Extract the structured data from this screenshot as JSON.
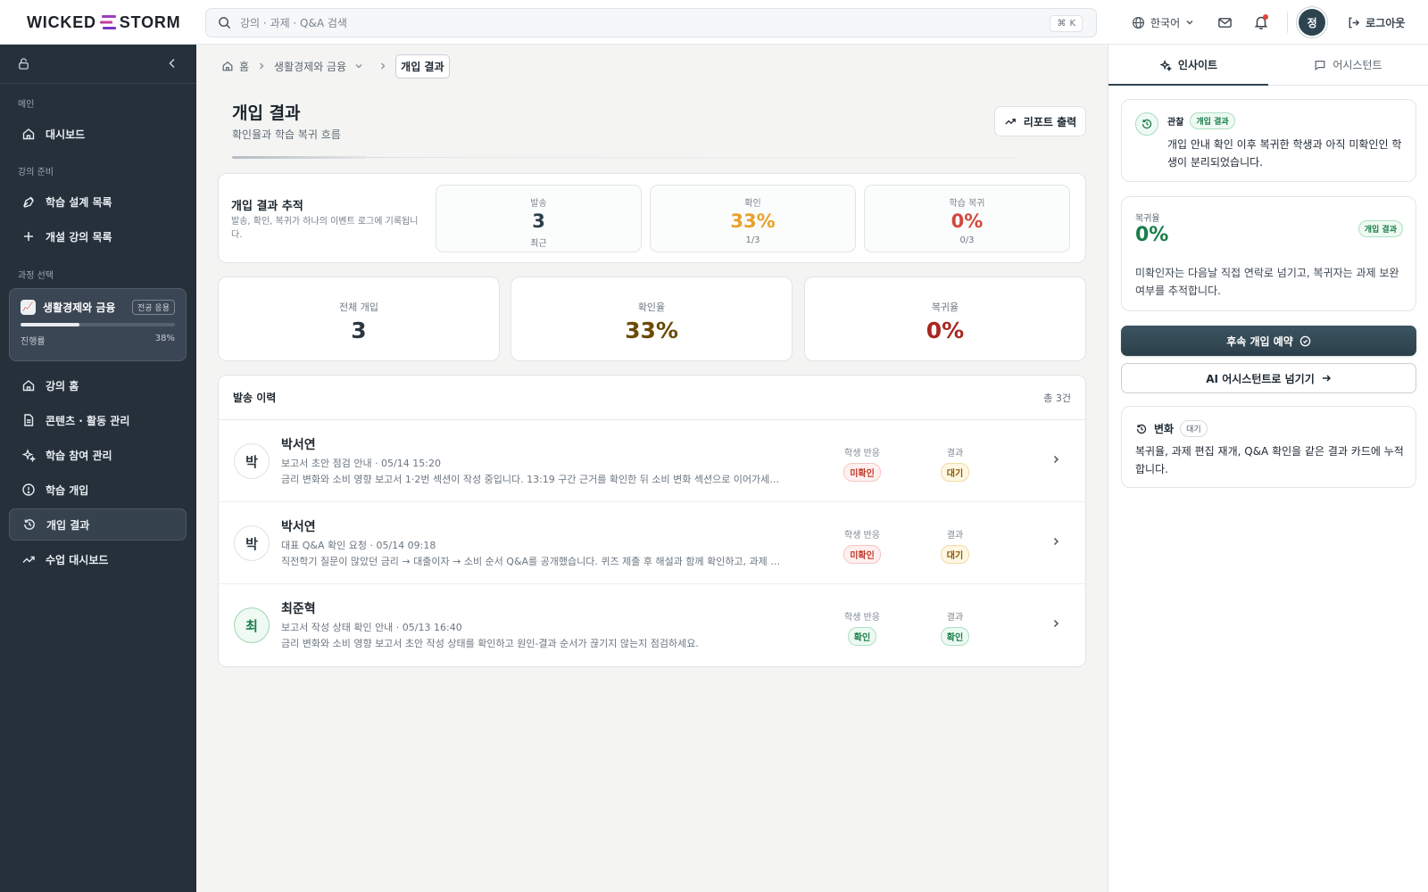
{
  "brand": {
    "left": "WICKED",
    "right": "STORM"
  },
  "search": {
    "placeholder": "강의 · 과제 · Q&A 검색",
    "shortcut_mod": "⌘",
    "shortcut_key": "K"
  },
  "topbar": {
    "language": "한국어",
    "avatar_initial": "정",
    "logout_label": "로그아웃"
  },
  "sidebar": {
    "sections": {
      "main": "메인",
      "prep": "강의 준비",
      "course_select": "과정 선택"
    },
    "items": {
      "dashboard": "대시보드",
      "design_list": "학습 설계 목록",
      "open_courses": "개설 강의 목록",
      "course_home": "강의 홈",
      "contents": "콘텐츠 · 활동 관리",
      "participation": "학습 참여 관리",
      "intervention": "학습 개입",
      "intervention_result": "개입 결과",
      "class_dashboard": "수업 대시보드"
    },
    "course": {
      "icon": "📈",
      "name": "생활경제와 금융",
      "tag": "전공 응용",
      "progress_label": "진행률",
      "progress_text": "38%",
      "progress": 0.38
    }
  },
  "breadcrumb": {
    "home": "홈",
    "course": "생활경제와 금융",
    "current": "개입 결과"
  },
  "page": {
    "title": "개입 결과",
    "subtitle": "확인율과 학습 복귀 흐름",
    "report_button": "리포트 출력"
  },
  "tracking": {
    "title": "개입 결과 추적",
    "desc": "발송, 확인, 복귀가 하나의 이벤트 로그에 기록됩니다.",
    "cards": [
      {
        "label": "발송",
        "value": "3",
        "sub": "최근",
        "color": "#2c3e48"
      },
      {
        "label": "확인",
        "value": "33%",
        "sub": "1/3",
        "color": "#e8a12a"
      },
      {
        "label": "학습 복귀",
        "value": "0%",
        "sub": "0/3",
        "color": "#d2493e"
      }
    ]
  },
  "stats": [
    {
      "label": "전체 개입",
      "value": "3",
      "color": "#2c3740"
    },
    {
      "label": "확인율",
      "value": "33%",
      "color": "#6b4a06"
    },
    {
      "label": "복귀율",
      "value": "0%",
      "color": "#a9271f"
    }
  ],
  "history": {
    "title": "발송 이력",
    "count": "총 3건",
    "col_reaction": "학생 반응",
    "col_result": "결과",
    "rows": [
      {
        "initial": "박",
        "name": "박서연",
        "meta": "보고서 초안 점검 안내 · 05/14 15:20",
        "desc": "금리 변화와 소비 영향 보고서 1·2번 섹션이 작성 중입니다. 13:19 구간 근거를 확인한 뒤 소비 변화 섹션으로 이어가세요.",
        "reaction": "미확인",
        "result": "대기"
      },
      {
        "initial": "박",
        "name": "박서연",
        "meta": "대표 Q&A 확인 요청 · 05/14 09:18",
        "desc": "직전학기 질문이 많았던 금리 → 대출이자 → 소비 순서 Q&A를 공개했습니다. 퀴즈 제출 후 해설과 함께 확인하고, 과제 문장에 단...",
        "reaction": "미확인",
        "result": "대기"
      },
      {
        "initial": "최",
        "name": "최준혁",
        "meta": "보고서 작성 상태 확인 안내 · 05/13 16:40",
        "desc": "금리 변화와 소비 영향 보고서 초안 작성 상태를 확인하고 원인-결과 순서가 끊기지 않는지 점검하세요.",
        "reaction": "확인",
        "result": "확인"
      }
    ]
  },
  "right_panel": {
    "tabs": {
      "insight": "인사이트",
      "assistant": "어시스턴트"
    },
    "observation": {
      "label": "관찰",
      "tag": "개입 결과",
      "text": "개입 안내 확인 이후 복귀한 학생과 아직 미확인인 학생이 분리되었습니다."
    },
    "return_rate": {
      "label": "복귀율",
      "value": "0%",
      "tag": "개입 결과",
      "desc": "미확인자는 다음날 직접 연락로 넘기고, 복귀자는 과제 보완 여부를 추적합니다."
    },
    "buttons": {
      "schedule": "후속 개입 예약",
      "assistant": "AI 어시스턴트로 넘기기"
    },
    "change": {
      "label": "변화",
      "tag": "대기",
      "text": "복귀율, 과제 편집 재개, Q&A 확인을 같은 결과 카드에 누적합니다."
    }
  }
}
